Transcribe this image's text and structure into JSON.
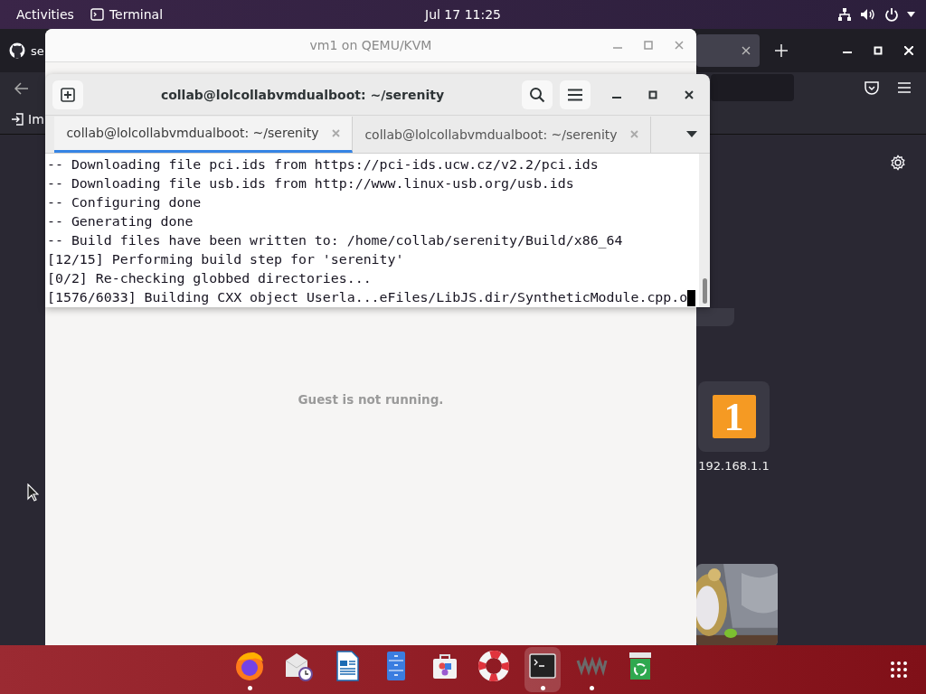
{
  "top_bar": {
    "activities": "Activities",
    "app": "Terminal",
    "clock": "Jul 17 11:25"
  },
  "browser": {
    "tab_title": "se",
    "bookmark": "Im"
  },
  "shortcuts": [
    {
      "kind": "blank"
    },
    {
      "kind": "site",
      "glyph": "1",
      "label": "192.168.1.1"
    },
    {
      "kind": "picture"
    }
  ],
  "vm_window": {
    "title": "vm1 on QEMU/KVM",
    "message": "Guest is not running."
  },
  "terminal": {
    "title": "collab@lolcollabvmdualboot: ~/serenity",
    "tabs": [
      {
        "label": "collab@lolcollabvmdualboot: ~/serenity",
        "selected": true
      },
      {
        "label": "collab@lolcollabvmdualboot: ~/serenity",
        "selected": false
      }
    ],
    "lines": [
      "-- Downloading file pci.ids from https://pci-ids.ucw.cz/v2.2/pci.ids",
      "-- Downloading file usb.ids from http://www.linux-usb.org/usb.ids",
      "-- Configuring done",
      "-- Generating done",
      "-- Build files have been written to: /home/collab/serenity/Build/x86_64",
      "[12/15] Performing build step for 'serenity'",
      "[0/2] Re-checking globbed directories...",
      "[1576/6033] Building CXX object Userla...eFiles/LibJS.dir/SyntheticModule.cpp.o"
    ]
  },
  "dock": [
    {
      "kind": "firefox",
      "running": true,
      "selected": false
    },
    {
      "kind": "mail",
      "running": false,
      "selected": false
    },
    {
      "kind": "writer",
      "running": false,
      "selected": false
    },
    {
      "kind": "cabinet",
      "running": false,
      "selected": false
    },
    {
      "kind": "software",
      "running": false,
      "selected": false
    },
    {
      "kind": "help",
      "running": false,
      "selected": false
    },
    {
      "kind": "terminal",
      "running": true,
      "selected": true
    },
    {
      "kind": "virt",
      "running": true,
      "selected": false
    },
    {
      "kind": "trash",
      "running": false,
      "selected": false
    }
  ]
}
